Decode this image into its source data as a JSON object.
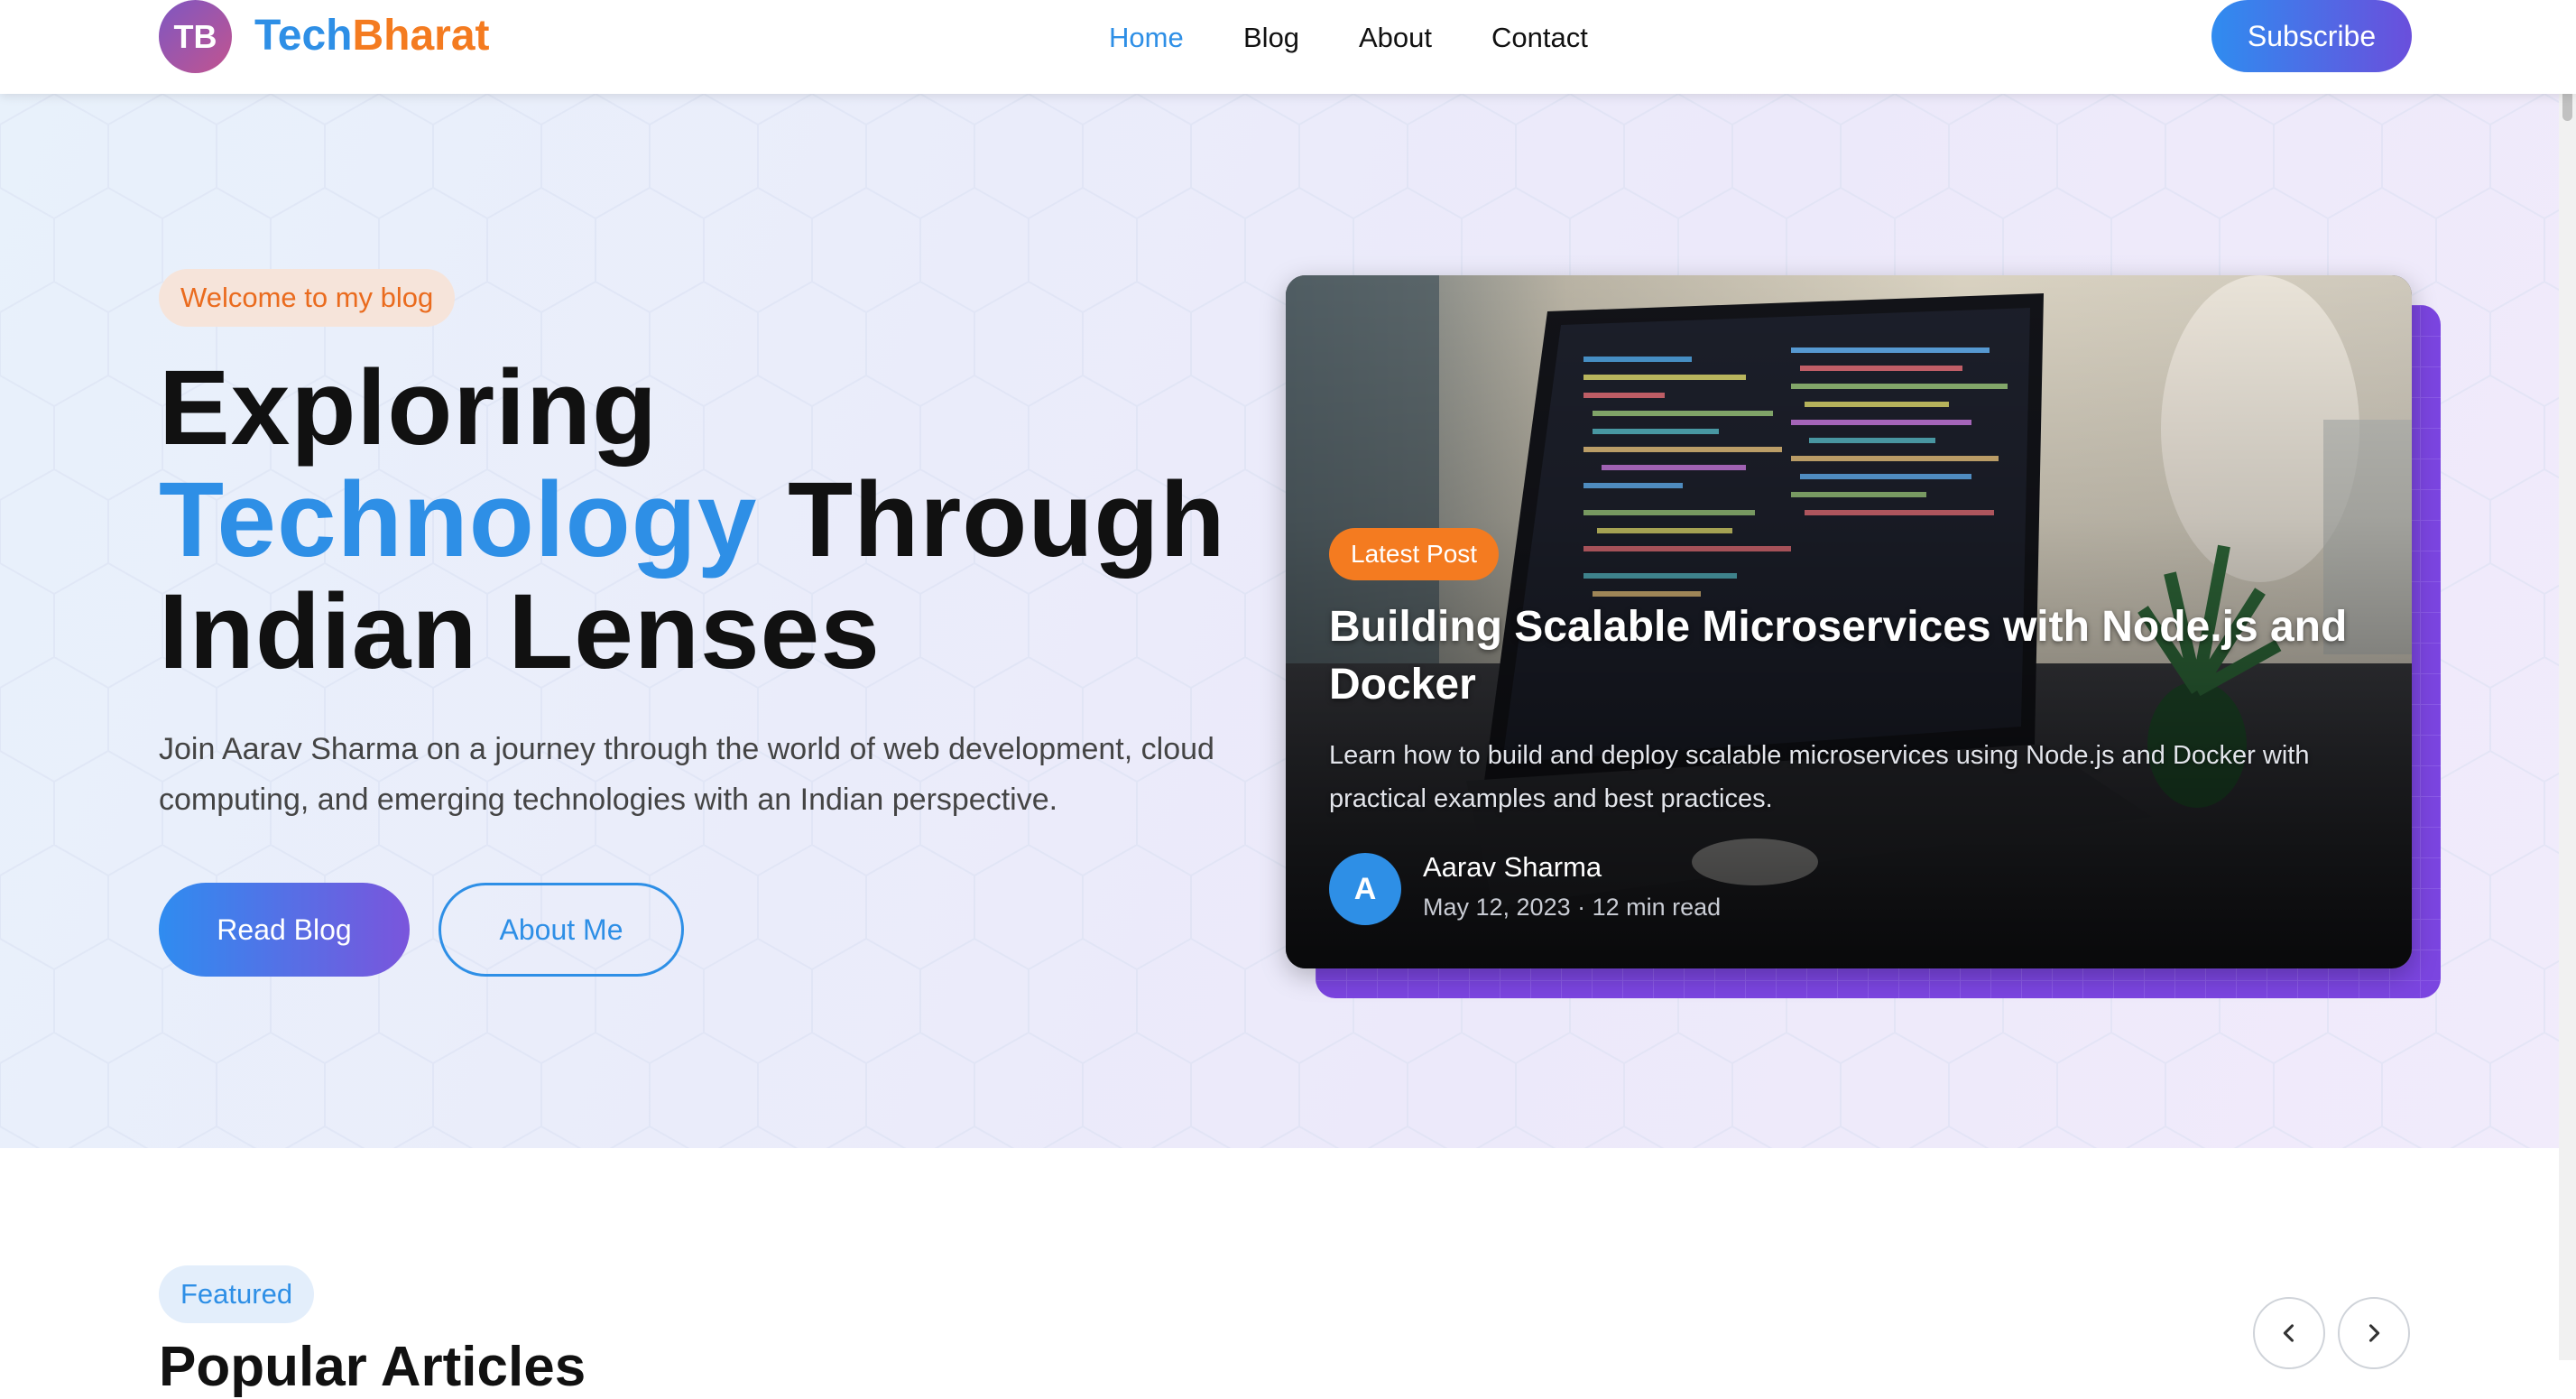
{
  "brand": {
    "initials": "TB",
    "name_part1": "Tech",
    "name_part2": "Bharat"
  },
  "nav": {
    "items": [
      {
        "label": "Home",
        "active": true
      },
      {
        "label": "Blog",
        "active": false
      },
      {
        "label": "About",
        "active": false
      },
      {
        "label": "Contact",
        "active": false
      }
    ],
    "subscribe_label": "Subscribe"
  },
  "hero": {
    "welcome_tag": "Welcome to my blog",
    "title_line1": "Exploring",
    "title_accent": "Technology",
    "title_line2_rest": " Through",
    "title_line3": "Indian Lenses",
    "description": "Join Aarav Sharma on a journey through the world of web development, cloud computing, and emerging technologies with an Indian perspective.",
    "primary_button": "Read Blog",
    "secondary_button": "About Me"
  },
  "featured_post": {
    "tag": "Latest Post",
    "title": "Building Scalable Microservices with Node.js and Docker",
    "excerpt": "Learn how to build and deploy scalable microservices using Node.js and Docker with practical examples and best practices.",
    "author_initial": "A",
    "author_name": "Aarav Sharma",
    "meta": "May 12, 2023 · 12 min read"
  },
  "featured_section": {
    "tag": "Featured",
    "title": "Popular Articles"
  },
  "colors": {
    "primary": "#2e8fe6",
    "accent_orange": "#f47b20",
    "purple": "#7b45e0"
  },
  "icons": {
    "prev": "chevron-left-icon",
    "next": "chevron-right-icon"
  }
}
